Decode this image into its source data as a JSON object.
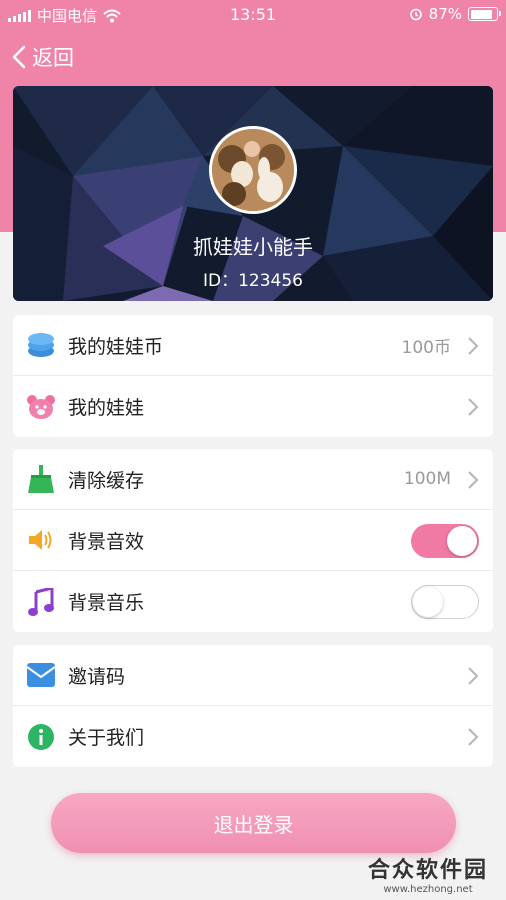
{
  "status_bar": {
    "carrier": "中国电信",
    "time": "13:51",
    "battery_text": "87%",
    "battery_level": 0.87
  },
  "nav": {
    "back_label": "返回"
  },
  "profile": {
    "nickname": "抓娃娃小能手",
    "user_id": "ID：123456"
  },
  "groups": {
    "wallet": [
      {
        "label": "我的娃娃币",
        "value": "100币",
        "icon": "coin-stack-icon"
      },
      {
        "label": "我的娃娃",
        "value": "",
        "icon": "bear-icon"
      }
    ],
    "settings": [
      {
        "label": "清除缓存",
        "value": "100M",
        "icon": "broom-icon"
      },
      {
        "label": "背景音效",
        "toggle_on": true,
        "icon": "speaker-icon"
      },
      {
        "label": "背景音乐",
        "toggle_on": false,
        "icon": "music-note-icon"
      }
    ],
    "misc": [
      {
        "label": "邀请码",
        "icon": "envelope-icon"
      },
      {
        "label": "关于我们",
        "icon": "info-icon"
      }
    ]
  },
  "logout_label": "退出登录",
  "watermark": {
    "main": "合众软件园",
    "url": "www.hezhong.net"
  },
  "colors": {
    "header_pink": "#ef84a8",
    "toggle_on": "#f07aa3",
    "logout_pink": "#f297b7"
  }
}
